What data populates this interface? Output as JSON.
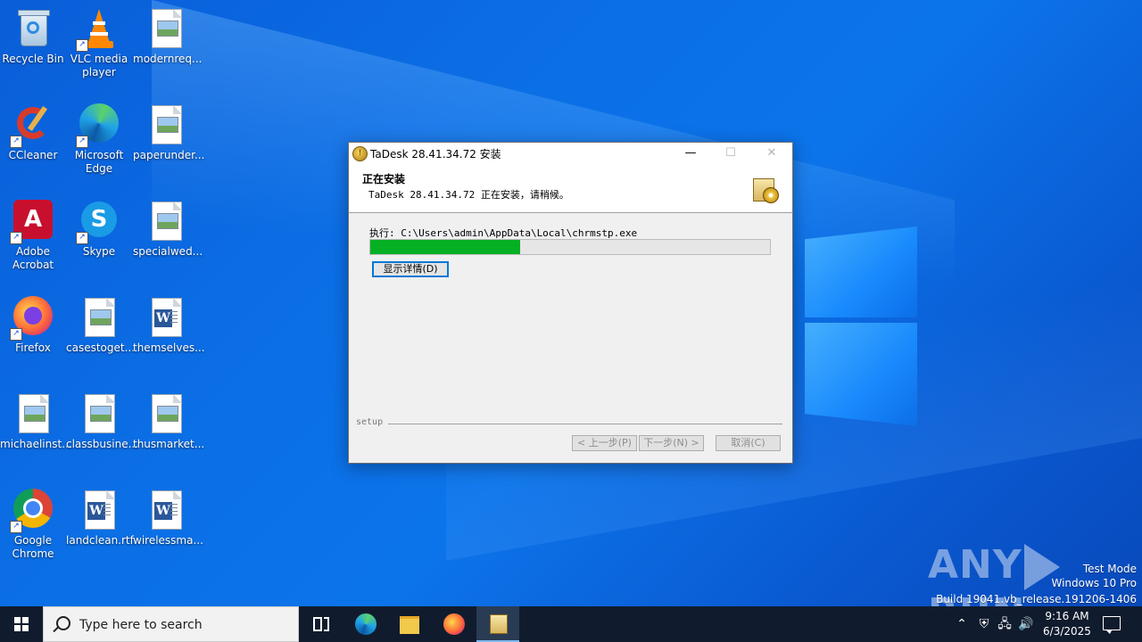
{
  "desktop": {
    "icons": [
      {
        "label": "Recycle Bin"
      },
      {
        "label": "VLC media player"
      },
      {
        "label": "modernreq..."
      },
      {
        "label": "CCleaner"
      },
      {
        "label": "Microsoft Edge"
      },
      {
        "label": "paperunder..."
      },
      {
        "label": "Adobe Acrobat"
      },
      {
        "label": "Skype"
      },
      {
        "label": "specialwed..."
      },
      {
        "label": "Firefox"
      },
      {
        "label": "casestoget..."
      },
      {
        "label": "themselves..."
      },
      {
        "label": "michaelinst..."
      },
      {
        "label": "classbusine..."
      },
      {
        "label": "thusmarket..."
      },
      {
        "label": "Google Chrome"
      },
      {
        "label": "landclean.rtf"
      },
      {
        "label": "wirelessma..."
      }
    ]
  },
  "installer": {
    "title": "TaDesk 28.41.34.72 安装",
    "header_title": "正在安装",
    "header_subtitle": "TaDesk 28.41.34.72 正在安装，请稍候。",
    "exec_text": "执行: C:\\Users\\admin\\AppData\\Local\\chrmstp.exe",
    "progress_fraction": 0.375,
    "show_details_label": "显示详情(D)",
    "branding": "setup",
    "back_label": "< 上一步(P)",
    "next_label": "下一步(N) >",
    "cancel_label": "取消(C)",
    "progress_color": "#06b025"
  },
  "watermark": {
    "logo_left": "ANY",
    "logo_right": "RUN",
    "line1": "Test Mode",
    "line2": "Windows 10 Pro",
    "line3": "Build 19041.vb_release.191206-1406"
  },
  "taskbar": {
    "search_placeholder": "Type here to search",
    "time": "9:16 AM",
    "date": "6/3/2025"
  }
}
